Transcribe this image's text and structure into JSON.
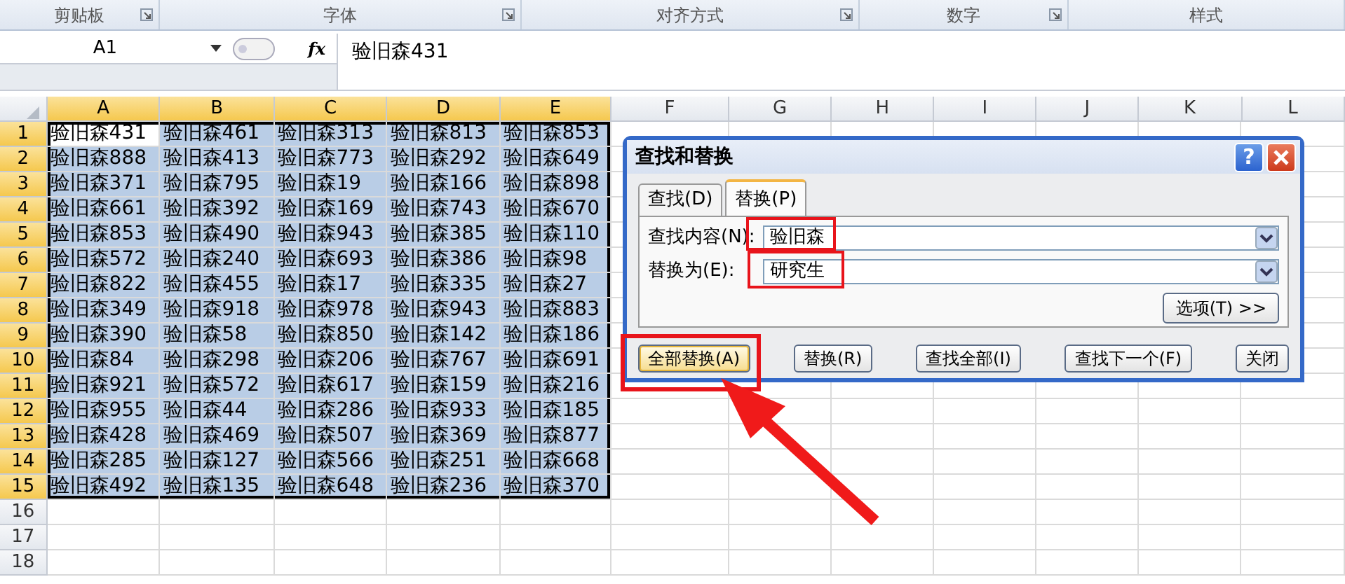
{
  "ribbon_groups": [
    {
      "label": "剪贴板",
      "launcher": true
    },
    {
      "label": "字体",
      "launcher": true
    },
    {
      "label": "对齐方式",
      "launcher": true
    },
    {
      "label": "数字",
      "launcher": true
    },
    {
      "label": "样式",
      "launcher": false
    }
  ],
  "formula_bar": {
    "name_box": "A1",
    "fx": "fx",
    "value": "验旧森431"
  },
  "sheet": {
    "columns": [
      {
        "label": "A",
        "selected": true
      },
      {
        "label": "B",
        "selected": true
      },
      {
        "label": "C",
        "selected": true
      },
      {
        "label": "D",
        "selected": true
      },
      {
        "label": "E",
        "selected": true
      },
      {
        "label": "F",
        "selected": false
      },
      {
        "label": "G",
        "selected": false
      },
      {
        "label": "H",
        "selected": false
      },
      {
        "label": "I",
        "selected": false
      },
      {
        "label": "J",
        "selected": false
      },
      {
        "label": "K",
        "selected": false
      },
      {
        "label": "L",
        "selected": false
      }
    ],
    "rows": [
      {
        "header": "1",
        "selected": true,
        "cells": [
          {
            "text": "验旧森431",
            "active": true
          },
          {
            "text": "验旧森461",
            "active": false
          },
          {
            "text": "验旧森313",
            "active": false
          },
          {
            "text": "验旧森813",
            "active": false
          },
          {
            "text": "验旧森853",
            "active": false
          }
        ]
      },
      {
        "header": "2",
        "selected": true,
        "cells": [
          {
            "text": "验旧森888",
            "active": false
          },
          {
            "text": "验旧森413",
            "active": false
          },
          {
            "text": "验旧森773",
            "active": false
          },
          {
            "text": "验旧森292",
            "active": false
          },
          {
            "text": "验旧森649",
            "active": false
          }
        ]
      },
      {
        "header": "3",
        "selected": true,
        "cells": [
          {
            "text": "验旧森371",
            "active": false
          },
          {
            "text": "验旧森795",
            "active": false
          },
          {
            "text": "验旧森19",
            "active": false
          },
          {
            "text": "验旧森166",
            "active": false
          },
          {
            "text": "验旧森898",
            "active": false
          }
        ]
      },
      {
        "header": "4",
        "selected": true,
        "cells": [
          {
            "text": "验旧森661",
            "active": false
          },
          {
            "text": "验旧森392",
            "active": false
          },
          {
            "text": "验旧森169",
            "active": false
          },
          {
            "text": "验旧森743",
            "active": false
          },
          {
            "text": "验旧森670",
            "active": false
          }
        ]
      },
      {
        "header": "5",
        "selected": true,
        "cells": [
          {
            "text": "验旧森853",
            "active": false
          },
          {
            "text": "验旧森490",
            "active": false
          },
          {
            "text": "验旧森943",
            "active": false
          },
          {
            "text": "验旧森385",
            "active": false
          },
          {
            "text": "验旧森110",
            "active": false
          }
        ]
      },
      {
        "header": "6",
        "selected": true,
        "cells": [
          {
            "text": "验旧森572",
            "active": false
          },
          {
            "text": "验旧森240",
            "active": false
          },
          {
            "text": "验旧森693",
            "active": false
          },
          {
            "text": "验旧森386",
            "active": false
          },
          {
            "text": "验旧森98",
            "active": false
          }
        ]
      },
      {
        "header": "7",
        "selected": true,
        "cells": [
          {
            "text": "验旧森822",
            "active": false
          },
          {
            "text": "验旧森455",
            "active": false
          },
          {
            "text": "验旧森17",
            "active": false
          },
          {
            "text": "验旧森335",
            "active": false
          },
          {
            "text": "验旧森27",
            "active": false
          }
        ]
      },
      {
        "header": "8",
        "selected": true,
        "cells": [
          {
            "text": "验旧森349",
            "active": false
          },
          {
            "text": "验旧森918",
            "active": false
          },
          {
            "text": "验旧森978",
            "active": false
          },
          {
            "text": "验旧森943",
            "active": false
          },
          {
            "text": "验旧森883",
            "active": false
          }
        ]
      },
      {
        "header": "9",
        "selected": true,
        "cells": [
          {
            "text": "验旧森390",
            "active": false
          },
          {
            "text": "验旧森58",
            "active": false
          },
          {
            "text": "验旧森850",
            "active": false
          },
          {
            "text": "验旧森142",
            "active": false
          },
          {
            "text": "验旧森186",
            "active": false
          }
        ]
      },
      {
        "header": "10",
        "selected": true,
        "cells": [
          {
            "text": "验旧森84",
            "active": false
          },
          {
            "text": "验旧森298",
            "active": false
          },
          {
            "text": "验旧森206",
            "active": false
          },
          {
            "text": "验旧森767",
            "active": false
          },
          {
            "text": "验旧森691",
            "active": false
          }
        ]
      },
      {
        "header": "11",
        "selected": true,
        "cells": [
          {
            "text": "验旧森921",
            "active": false
          },
          {
            "text": "验旧森572",
            "active": false
          },
          {
            "text": "验旧森617",
            "active": false
          },
          {
            "text": "验旧森159",
            "active": false
          },
          {
            "text": "验旧森216",
            "active": false
          }
        ]
      },
      {
        "header": "12",
        "selected": true,
        "cells": [
          {
            "text": "验旧森955",
            "active": false
          },
          {
            "text": "验旧森44",
            "active": false
          },
          {
            "text": "验旧森286",
            "active": false
          },
          {
            "text": "验旧森933",
            "active": false
          },
          {
            "text": "验旧森185",
            "active": false
          }
        ]
      },
      {
        "header": "13",
        "selected": true,
        "cells": [
          {
            "text": "验旧森428",
            "active": false
          },
          {
            "text": "验旧森469",
            "active": false
          },
          {
            "text": "验旧森507",
            "active": false
          },
          {
            "text": "验旧森369",
            "active": false
          },
          {
            "text": "验旧森877",
            "active": false
          }
        ]
      },
      {
        "header": "14",
        "selected": true,
        "cells": [
          {
            "text": "验旧森285",
            "active": false
          },
          {
            "text": "验旧森127",
            "active": false
          },
          {
            "text": "验旧森566",
            "active": false
          },
          {
            "text": "验旧森251",
            "active": false
          },
          {
            "text": "验旧森668",
            "active": false
          }
        ]
      },
      {
        "header": "15",
        "selected": true,
        "cells": [
          {
            "text": "验旧森492",
            "active": false
          },
          {
            "text": "验旧森135",
            "active": false
          },
          {
            "text": "验旧森648",
            "active": false
          },
          {
            "text": "验旧森236",
            "active": false
          },
          {
            "text": "验旧森370",
            "active": false
          }
        ]
      },
      {
        "header": "16",
        "selected": false
      },
      {
        "header": "17",
        "selected": false
      },
      {
        "header": "18",
        "selected": false
      }
    ]
  },
  "dialog": {
    "title": "查找和替换",
    "help_button": "?",
    "tabs": [
      {
        "label": "查找(D)",
        "selected": false
      },
      {
        "label": "替换(P)",
        "selected": true
      }
    ],
    "fields": [
      {
        "label": "查找内容(N):",
        "value": "验旧森"
      },
      {
        "label": "替换为(E):",
        "value": "研究生"
      }
    ],
    "options_button": "选项(T) >>",
    "buttons": [
      {
        "label": "全部替换(A)",
        "default": true
      },
      {
        "label": "替换(R)",
        "default": false
      },
      {
        "label": "查找全部(I)",
        "default": false
      },
      {
        "label": "查找下一个(F)",
        "default": false
      },
      {
        "label": "关闭",
        "default": false
      }
    ]
  }
}
